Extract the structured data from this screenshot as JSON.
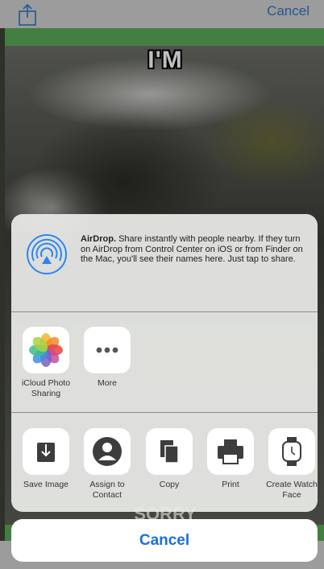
{
  "nav": {
    "cancel_label": "Cancel"
  },
  "meme": {
    "top_text": "I'M",
    "bottom_text": "SORRY"
  },
  "airdrop": {
    "title": "AirDrop.",
    "description": "Share instantly with people nearby. If they turn on AirDrop from Control Center on iOS or from Finder on the Mac, you'll see their names here. Just tap to share."
  },
  "share_apps": [
    {
      "label": "iCloud Photo Sharing",
      "icon": "photos-icon"
    },
    {
      "label": "More",
      "icon": "more-icon"
    }
  ],
  "actions": [
    {
      "label": "Save Image",
      "icon": "save-image-icon"
    },
    {
      "label": "Assign to Contact",
      "icon": "contact-icon"
    },
    {
      "label": "Copy",
      "icon": "copy-icon"
    },
    {
      "label": "Print",
      "icon": "print-icon"
    },
    {
      "label": "Create Watch Face",
      "icon": "watch-icon"
    }
  ],
  "cancel_label": "Cancel",
  "colors": {
    "accent": "#1b6fe0",
    "green_bar": "#5aa85a",
    "airdrop_blue": "#2d86f0"
  }
}
